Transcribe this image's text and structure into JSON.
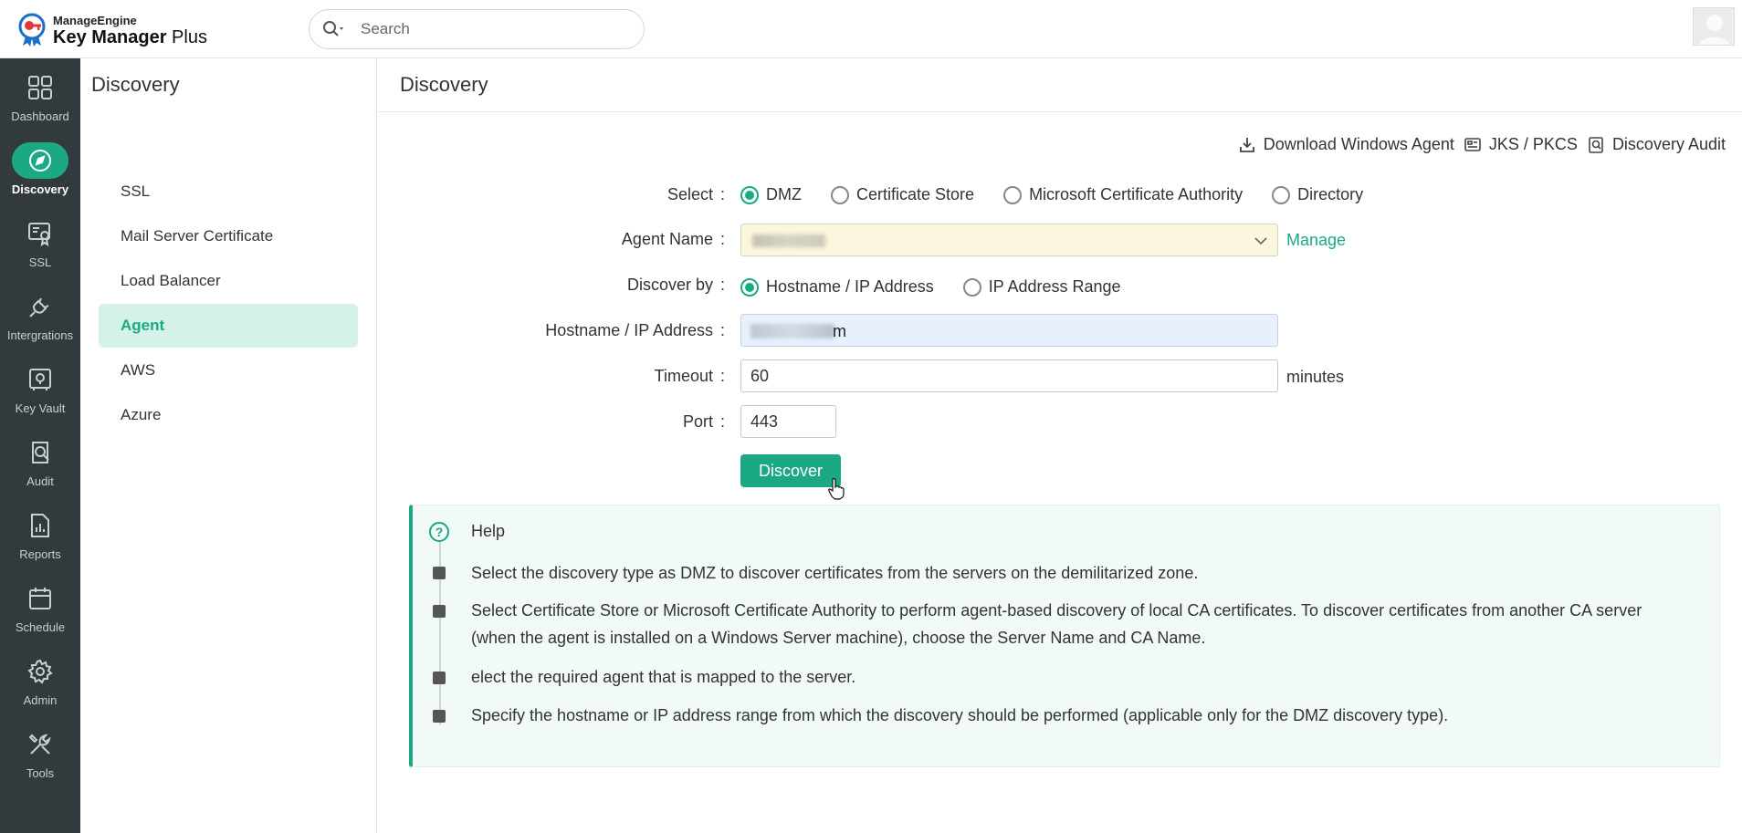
{
  "app": {
    "brand": "ManageEngine",
    "product_main": "Key Manager",
    "product_suffix": " Plus"
  },
  "search": {
    "placeholder": "Search"
  },
  "leftnav": {
    "items": [
      {
        "label": "Dashboard",
        "icon": "dashboard-icon"
      },
      {
        "label": "Discovery",
        "icon": "compass-icon",
        "active": true
      },
      {
        "label": "SSL",
        "icon": "certificate-icon"
      },
      {
        "label": "Intergrations",
        "icon": "plug-icon"
      },
      {
        "label": "Key Vault",
        "icon": "vault-icon"
      },
      {
        "label": "Audit",
        "icon": "audit-icon"
      },
      {
        "label": "Reports",
        "icon": "reports-icon"
      },
      {
        "label": "Schedule",
        "icon": "calendar-icon"
      },
      {
        "label": "Admin",
        "icon": "gear-icon"
      },
      {
        "label": "Tools",
        "icon": "tools-icon"
      }
    ]
  },
  "subnav": {
    "title": "Discovery",
    "items": [
      {
        "label": "SSL"
      },
      {
        "label": "Mail Server Certificate"
      },
      {
        "label": "Load Balancer"
      },
      {
        "label": "Agent",
        "active": true
      },
      {
        "label": "AWS"
      },
      {
        "label": "Azure"
      }
    ]
  },
  "main": {
    "title": "Discovery",
    "toplinks": {
      "download": "Download Windows Agent",
      "jks": "JKS / PKCS",
      "audit": "Discovery Audit"
    },
    "form": {
      "select_label": "Select",
      "select_options": [
        "DMZ",
        "Certificate Store",
        "Microsoft Certificate Authority",
        "Directory"
      ],
      "select_value": "DMZ",
      "agent_label": "Agent Name",
      "manage": "Manage",
      "discover_by_label": "Discover by",
      "discover_by_options": [
        "Hostname / IP Address",
        "IP Address Range"
      ],
      "discover_by_value": "Hostname / IP Address",
      "hostname_label": "Hostname / IP Address",
      "hostname_visible_suffix": "m",
      "timeout_label": "Timeout",
      "timeout_value": "60",
      "timeout_unit": "minutes",
      "port_label": "Port",
      "port_value": "443",
      "colon": ":",
      "discover_button": "Discover"
    },
    "help": {
      "title": "Help",
      "icon": "?",
      "items": [
        "Select the discovery type as DMZ to discover certificates from the servers on the demilitarized zone.",
        "Select Certificate Store or Microsoft Certificate Authority to perform agent-based discovery of local CA certificates. To discover certificates from another CA server (when the agent is installed on a Windows Server machine), choose the Server Name and CA Name.",
        "elect the required agent that is mapped to the server.",
        "Specify the hostname or IP address range from which the discovery should be performed (applicable only for the DMZ discovery type)."
      ]
    }
  },
  "colors": {
    "accent": "#1ba984",
    "sidebar": "#323a3d",
    "active_subnav_bg": "#d4f2e8"
  }
}
